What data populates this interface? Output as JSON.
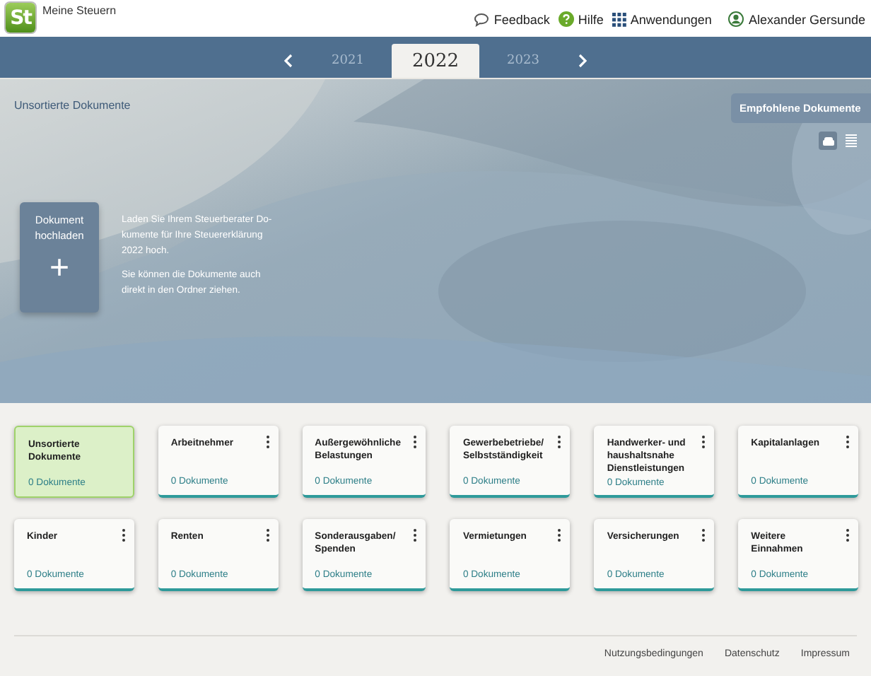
{
  "app": {
    "title": "Meine Steuern",
    "logo": "St"
  },
  "header_links": [
    {
      "kind": "feedback",
      "label": "Feedback"
    },
    {
      "kind": "help",
      "label": "Hilfe"
    },
    {
      "kind": "apps",
      "label": "Anwendungen"
    },
    {
      "kind": "user",
      "label": "Alexander Gersunde"
    }
  ],
  "years": [
    {
      "label": "2021",
      "selected": false
    },
    {
      "label": "2022",
      "selected": true
    },
    {
      "label": "2023",
      "selected": false
    }
  ],
  "hero": {
    "title": "Unsortierte Dokumente",
    "recommended_button": "Empfohlene Dokumente",
    "views": [
      {
        "kind": "grid",
        "selected": true
      },
      {
        "kind": "list",
        "selected": false
      }
    ],
    "upload_label": "Dokument hochladen",
    "upload_icon": "+",
    "texts": [
      "Laden Sie Ihrem Steuerberater Do-kumente für Ihre Steuererklärung 2022 hoch.",
      "Sie können die Dokumente auch direkt in den Ordner ziehen."
    ]
  },
  "folders": [
    {
      "name": "Unsortierte Dokumente",
      "count": "0 Dokumente",
      "selected": true
    },
    {
      "name": "Arbeitnehmer",
      "count": "0 Dokumente",
      "selected": false
    },
    {
      "name": "Außergewöhnliche Belastungen",
      "count": "0 Dokumente",
      "selected": false
    },
    {
      "name": "Gewerbebetriebe/ Selbstständigkeit",
      "count": "0 Dokumente",
      "selected": false
    },
    {
      "name": "Handwerker- und haushaltsnahe Dienstleistungen",
      "count": "0 Dokumente",
      "selected": false
    },
    {
      "name": "Kapitalanlagen",
      "count": "0 Dokumente",
      "selected": false
    },
    {
      "name": "Kinder",
      "count": "0 Dokumente",
      "selected": false
    },
    {
      "name": "Renten",
      "count": "0 Dokumente",
      "selected": false
    },
    {
      "name": "Sonderausgaben/ Spenden",
      "count": "0 Dokumente",
      "selected": false
    },
    {
      "name": "Vermietungen",
      "count": "0 Dokumente",
      "selected": false
    },
    {
      "name": "Versicherungen",
      "count": "0 Dokumente",
      "selected": false
    },
    {
      "name": "Weitere Einnahmen",
      "count": "0 Dokumente",
      "selected": false
    }
  ],
  "footer_links": [
    "Nutzungsbedingungen",
    "Datenschutz",
    "Impressum"
  ]
}
